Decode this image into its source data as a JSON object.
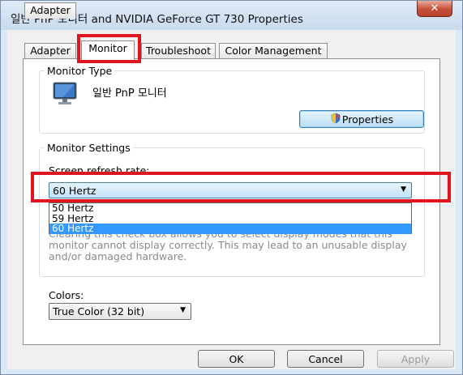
{
  "window": {
    "title": "일반 PnP 모니터 and NVIDIA GeForce GT 730 Properties",
    "close_label": "✕"
  },
  "tabs": [
    {
      "label": "Adapter"
    },
    {
      "label": "Monitor"
    },
    {
      "label": "Troubleshoot"
    },
    {
      "label": "Color Management"
    }
  ],
  "monitor_type": {
    "group_label": "Monitor Type",
    "monitor_name": "일반 PnP 모니터",
    "properties_label": "Properties"
  },
  "monitor_settings": {
    "group_label": "Monitor Settings",
    "refresh_label": "Screen refresh rate:",
    "refresh_value": "60 Hertz",
    "refresh_options": [
      "50 Hertz",
      "59 Hertz",
      "60 Hertz"
    ],
    "description": "Clearing this check box allows you to select display modes that this monitor cannot display correctly. This may lead to an unusable display and/or damaged hardware."
  },
  "colors": {
    "label": "Colors:",
    "value": "True Color (32 bit)"
  },
  "buttons": {
    "ok": "OK",
    "cancel": "Cancel",
    "apply": "Apply"
  },
  "highlight_color": "#e0141e",
  "selection_color": "#3399ff"
}
